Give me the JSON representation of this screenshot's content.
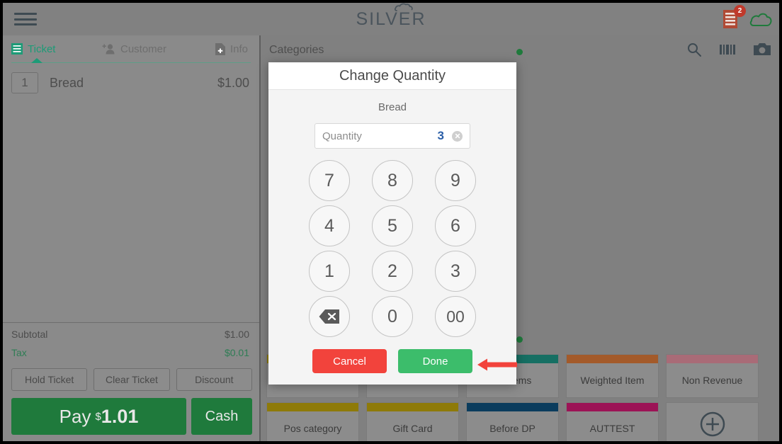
{
  "app": {
    "logo_text": "SILVER",
    "menu_icon": "hamburger-menu-icon",
    "receipt_icon": "receipt-icon",
    "receipt_badge": "2",
    "cloud_icon": "cloud-icon"
  },
  "ticket_panel": {
    "tabs": [
      {
        "label": "Ticket",
        "icon": "list-icon",
        "active": true
      },
      {
        "label": "Customer",
        "icon": "add-person-icon",
        "active": false
      },
      {
        "label": "Info",
        "icon": "document-add-icon",
        "active": false
      }
    ],
    "items": [
      {
        "qty": "1",
        "name": "Bread",
        "price": "$1.00"
      }
    ],
    "totals": [
      {
        "label": "Subtotal",
        "value": "$1.00"
      },
      {
        "label": "Tax",
        "value": "$0.01"
      }
    ],
    "buttons": {
      "hold_ticket": "Hold Ticket",
      "clear_ticket": "Clear Ticket",
      "discount": "Discount"
    },
    "pay": {
      "label": "Pay",
      "currency": "$",
      "amount": "1.01",
      "cash_label": "Cash"
    }
  },
  "content": {
    "title": "Categories",
    "tool_icons": [
      "search-icon",
      "barcode-icon",
      "camera-icon"
    ],
    "tiles": [
      {
        "name": "on Items",
        "color": "#166f63"
      },
      {
        "name": "Weighted Item",
        "color": "#a35a2a"
      },
      {
        "name": "Non Revenue",
        "color": "#a96b77"
      },
      {
        "name": "Pos category",
        "color": "#8e7a09"
      },
      {
        "name": "Gift Card",
        "color": "#8e7a09"
      },
      {
        "name": "Before DP",
        "color": "#0b3c5d"
      },
      {
        "name": "AUTTEST",
        "color": "#9c1356"
      },
      {
        "name": "",
        "color": "",
        "add": true
      }
    ],
    "add_tile_icon": "plus-circle-icon"
  },
  "dialog": {
    "title": "Change Quantity",
    "item_name": "Bread",
    "input": {
      "placeholder": "Quantity",
      "value": "3",
      "clear_icon": "clear-circle-icon"
    },
    "keys": [
      [
        "7",
        "8",
        "9"
      ],
      [
        "4",
        "5",
        "6"
      ],
      [
        "1",
        "2",
        "3"
      ],
      [
        "backspace",
        "0",
        "00"
      ]
    ],
    "backspace_icon": "backspace-icon",
    "cancel_label": "Cancel",
    "done_label": "Done"
  },
  "annotation": {
    "arrow_icon": "left-arrow-annotation",
    "color": "#f2433c"
  },
  "colors": {
    "accent_green": "#1d9b77",
    "pay_green": "#1f7a3c",
    "done_green": "#3cbd6b",
    "cancel_red": "#f2433c",
    "badge_red": "#c0392b",
    "panel_gray": "#8a8a8a"
  }
}
